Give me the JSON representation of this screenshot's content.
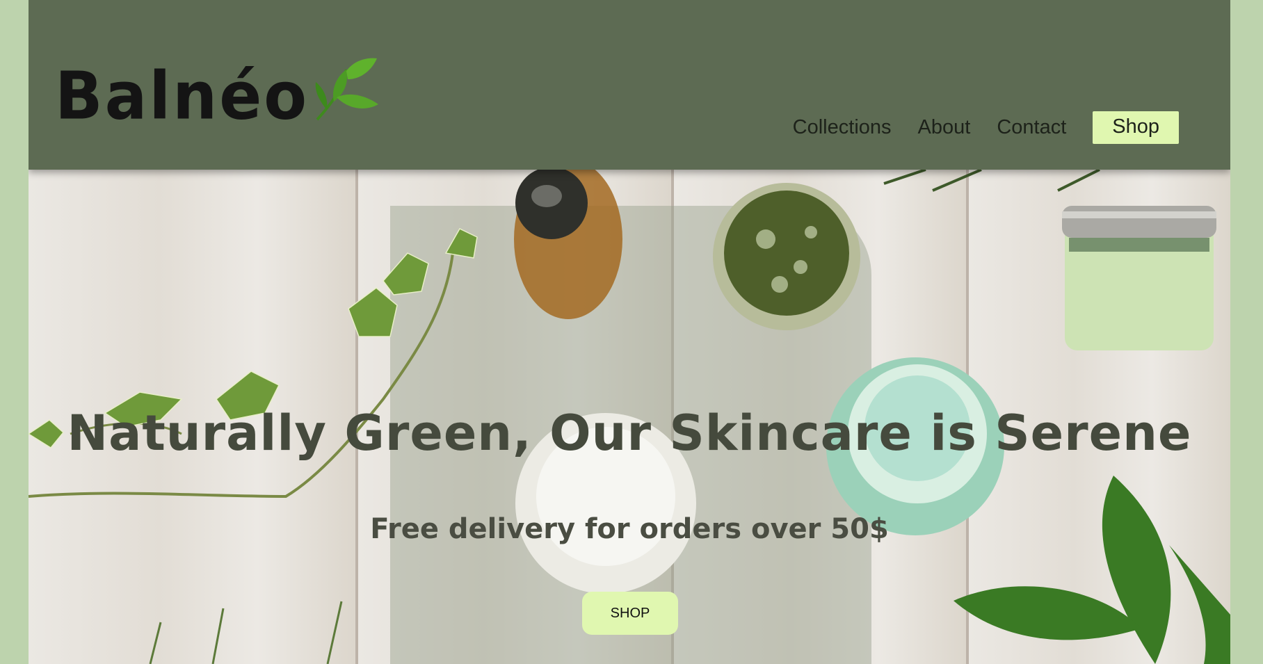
{
  "brand": {
    "name": "Balnéo",
    "leaf_icon": "leaf-sprig-icon",
    "colors": {
      "header_bg": "#5d6b53",
      "accent": "#e0f7b0",
      "page_bg": "#bdd3ad"
    }
  },
  "nav": {
    "items": [
      {
        "label": "Collections"
      },
      {
        "label": "About"
      },
      {
        "label": "Contact"
      }
    ],
    "shop_label": "Shop"
  },
  "hero": {
    "headline": "Naturally Green, Our Skincare is Serene",
    "subline": "Free delivery for orders over 50$",
    "cta_label": "SHOP"
  }
}
